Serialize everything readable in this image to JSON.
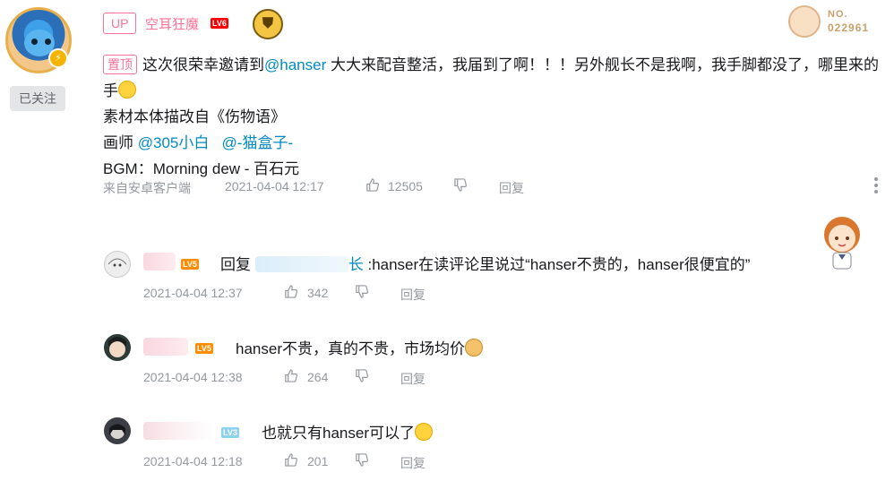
{
  "main_comment": {
    "up_tag": "UP",
    "username": "空耳狂魔",
    "level": "LV6",
    "fan_card": {
      "label": "NO.",
      "number": "022961"
    },
    "follow_label": "已关注",
    "pin_label": "置顶",
    "line1_a": "这次很荣幸邀请到",
    "mention1": "@hanser",
    "line1_b": " 大大来配音整活，我届到了啊！！！另外舰长不是我啊，我手脚都没了，哪里来的手",
    "line2": "素材本体描改自《伤物语》",
    "line3_a": "画师 ",
    "mention2": "@305小白",
    "mention3": "@-猫盒子-",
    "line4": "BGM：Morning dew - 百石元",
    "source": "来自安卓客户端",
    "time": "2021-04-04 12:17",
    "likes": "12505",
    "reply_label": "回复"
  },
  "replies": [
    {
      "level": "LV5",
      "reply_prefix": "回复 ",
      "target_tail": "长",
      "text": ":hanser在读评论里说过“hanser不贵的，hanser很便宜的”",
      "time": "2021-04-04 12:37",
      "likes": "342",
      "reply_label": "回复"
    },
    {
      "level": "LV5",
      "text": "hanser不贵，真的不贵，市场均价",
      "time": "2021-04-04 12:38",
      "likes": "264",
      "reply_label": "回复"
    },
    {
      "level": "LV3",
      "text": "也就只有hanser可以了",
      "time": "2021-04-04 12:18",
      "likes": "201",
      "reply_label": "回复"
    }
  ],
  "icons": [
    "like-icon",
    "dislike-icon",
    "more-icon",
    "laugh-emoji-icon",
    "doge-emoji-icon",
    "blush-emoji-icon",
    "lightning-badge-icon",
    "medal-icon"
  ],
  "colors": {
    "brand_pink": "#fb7299",
    "link_blue": "#008ac5",
    "meta_gray": "#9499a0",
    "lv6": "#ff0000",
    "lv5": "#ff8c00",
    "lv3": "#8bd1f0"
  }
}
